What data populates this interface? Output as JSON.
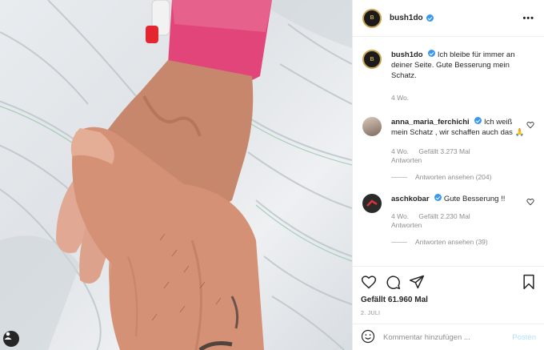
{
  "post": {
    "username": "bush1do",
    "more_label": "•••"
  },
  "caption": {
    "username": "bush1do",
    "text": "Ich bleibe für immer an deiner Seite. Gute Besserung mein Schatz.",
    "time": "4 Wo."
  },
  "comments": [
    {
      "username": "anna_maria_ferchichi",
      "text": "Ich weiß mein Schatz , wir schaffen auch das 🙏",
      "time": "4 Wo.",
      "likes": "Gefällt 3.273 Mal",
      "reply": "Antworten",
      "view_replies": "Antworten ansehen (204)"
    },
    {
      "username": "aschkobar",
      "text": "Gute Besserung !!",
      "time": "4 Wo.",
      "likes": "Gefällt 2.230 Mal",
      "reply": "Antworten",
      "view_replies": "Antworten ansehen (39)"
    }
  ],
  "actions": {
    "likes": "Gefällt 61.960 Mal",
    "date": "2. JULI"
  },
  "comment_box": {
    "placeholder": "Kommentar hinzufügen ...",
    "post_label": "Posten"
  },
  "icons": {
    "like": "heart-icon",
    "comment": "comment-icon",
    "share": "share-icon",
    "save": "bookmark-icon",
    "emoji": "emoji-icon",
    "tag": "user-tag-icon"
  },
  "colors": {
    "verified": "#3897f0",
    "post_button": "#b2dffc",
    "wristband": "#e2457a"
  }
}
